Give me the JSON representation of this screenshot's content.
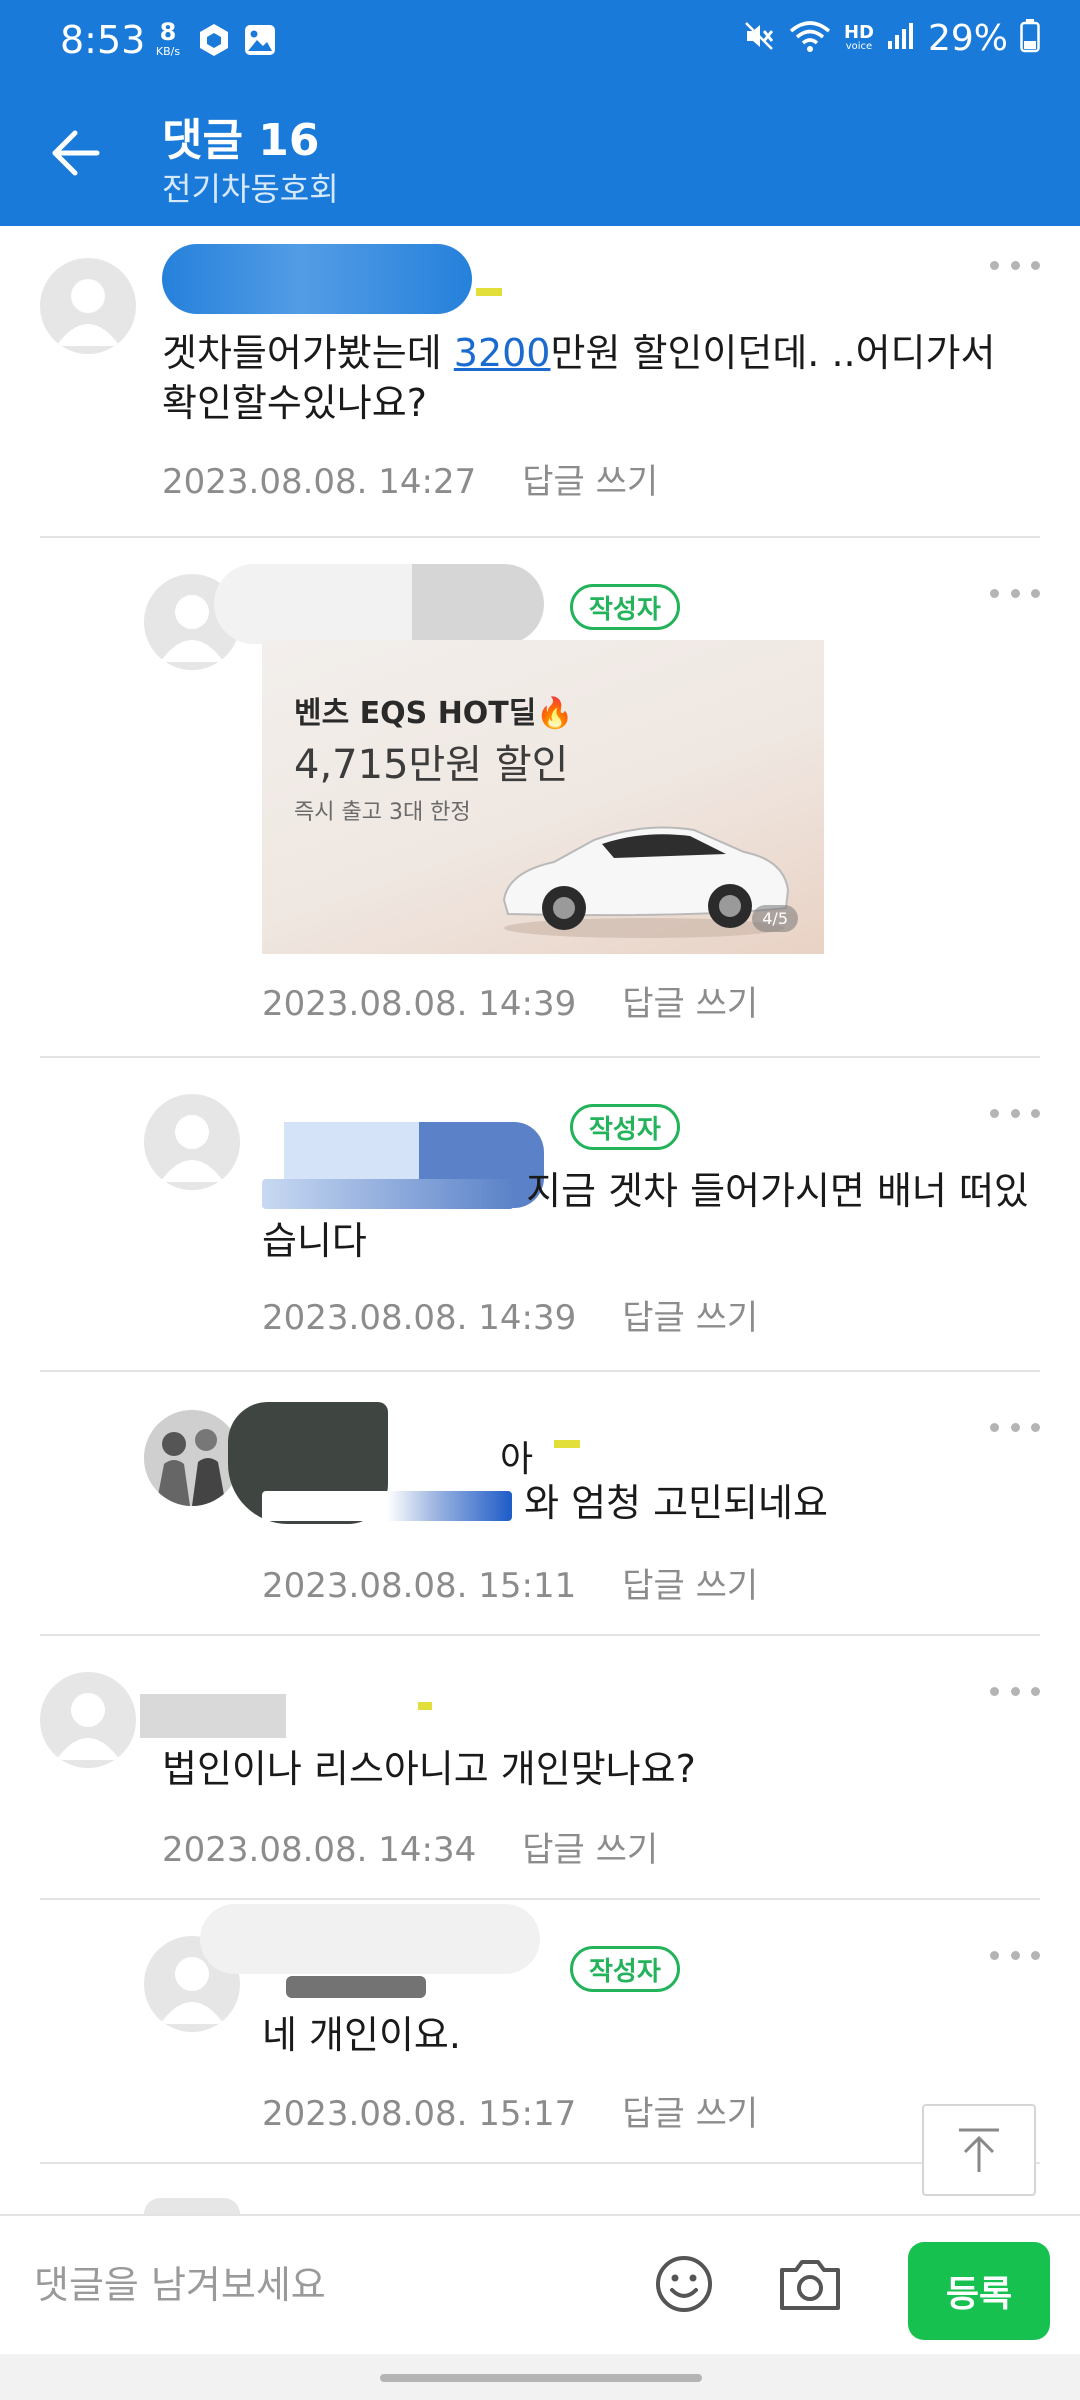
{
  "status_bar": {
    "time": "8:53",
    "net_speed": "8",
    "net_unit": "KB/s",
    "battery": "29%",
    "hd_label": "HD",
    "hd_sub": "voice"
  },
  "header": {
    "title": "댓글 16",
    "subtitle": "전기차동호회"
  },
  "comments": [
    {
      "text_before": "겟차들어가봤는데 ",
      "link": "3200",
      "text_after": "만원 할인이던데. ..어디가서 확인할수있나요?",
      "timestamp": "2023.08.08. 14:27",
      "reply_label": "답글 쓰기"
    },
    {
      "badge": "작성자",
      "ad_image": {
        "line1": "벤츠 EQS HOT딜🔥",
        "line2": "4,715만원 할인",
        "line3": "즉시 출고 3대 한정",
        "page": "4/5"
      },
      "timestamp": "2023.08.08. 14:39",
      "reply_label": "답글 쓰기"
    },
    {
      "badge": "작성자",
      "text": "지금 겟차 들어가시면 배너 떠있습니다",
      "timestamp": "2023.08.08. 14:39",
      "reply_label": "답글 쓰기"
    },
    {
      "name_fragment": "아",
      "text": "와 엄청 고민되네요",
      "timestamp": "2023.08.08. 15:11",
      "reply_label": "답글 쓰기"
    },
    {
      "text": "법인이나 리스아니고 개인맞나요?",
      "timestamp": "2023.08.08. 14:34",
      "reply_label": "답글 쓰기"
    },
    {
      "badge": "작성자",
      "text": "네 개인이요.",
      "timestamp": "2023.08.08. 15:17",
      "reply_label": "답글 쓰기"
    }
  ],
  "bottom_bar": {
    "placeholder": "댓글을 남겨보세요",
    "submit_label": "등록"
  },
  "colors": {
    "brand_blue": "#1a7ad9",
    "submit_green": "#16c150",
    "badge_green": "#23b35a"
  }
}
